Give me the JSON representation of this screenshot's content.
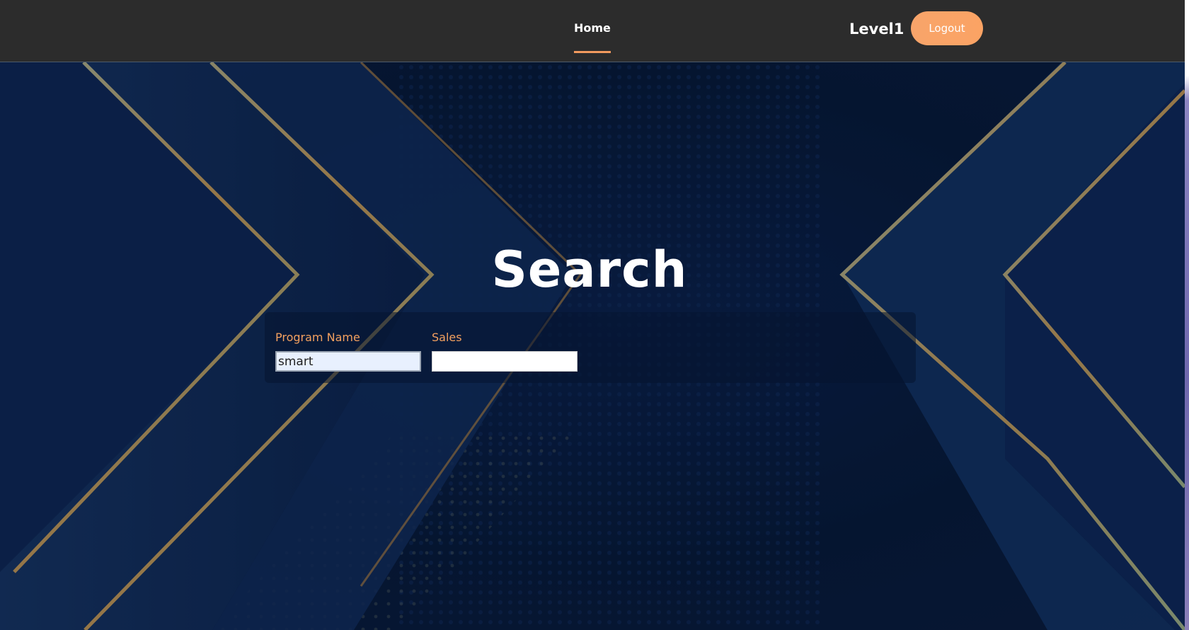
{
  "navbar": {
    "home_label": "Home",
    "user_label": "Level1",
    "logout_label": "Logout"
  },
  "search": {
    "title": "Search",
    "fields": [
      {
        "label": "Program Name",
        "value": "smart"
      },
      {
        "label": "Sales",
        "value": ""
      }
    ]
  },
  "colors": {
    "navbar_bg": "#2c2c2c",
    "accent": "#f29a5e",
    "label": "#f3a05f",
    "background": "#0b1f3f"
  }
}
